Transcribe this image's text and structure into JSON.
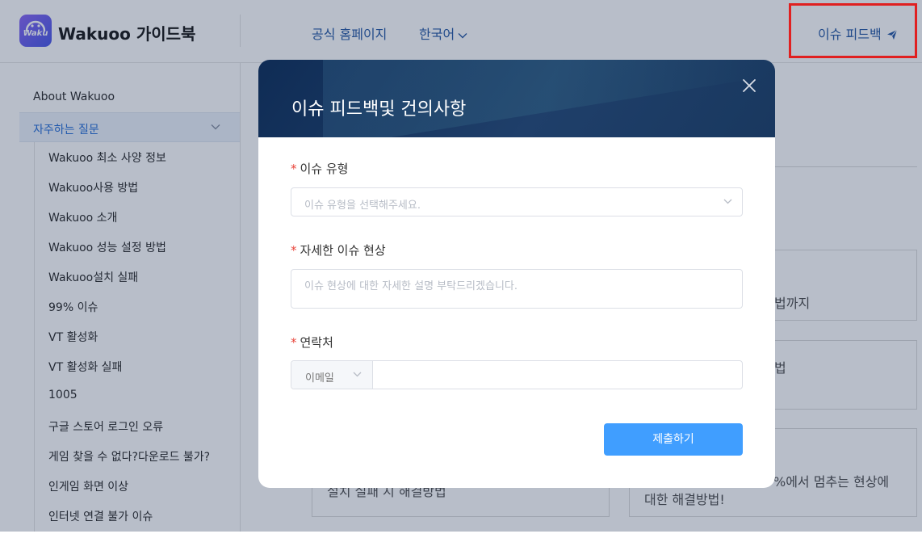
{
  "header": {
    "logo_text": "Waku",
    "brand_title": "Wakuoo 가이드북",
    "nav_home": "공식 홈페이지",
    "nav_lang": "한국어",
    "feedback_label": "이슈 피드백"
  },
  "sidebar": {
    "top_item": "About Wakuoo",
    "active_section": "자주하는 질문",
    "items": [
      "Wakuoo 최소 사양 정보",
      "Wakuoo사용 방법",
      "Wakuoo 소개",
      "Wakuoo 성능 설정 방법",
      "Wakuoo설치 실패",
      "99% 이슈",
      "VT 활성화",
      "VT 활성화 실패",
      "1005",
      "구글 스토어 로그인 오류",
      "게임 찾을 수 없다?다운로드 불가?",
      "인게임 화면 이상",
      "인터넷 연결 불가 이슈"
    ]
  },
  "main": {
    "card1_text": "법까지",
    "card2_text": "법",
    "card3_text": "설치 실패 시 해결방법",
    "card4_line1": "%에서 멈추는 현상에",
    "card4_line2": "대한 해결방법!"
  },
  "modal": {
    "title": "이슈 피드백및 건의사항",
    "required_mark": "*",
    "issue_type_label": "이슈 유형",
    "issue_type_placeholder": "이슈 유형을 선택해주세요.",
    "detail_label": "자세한 이슈 현상",
    "detail_placeholder": "이슈 현상에 대한 자세한 설명 부탁드리겠습니다.",
    "contact_label": "연락처",
    "contact_type": "이메일",
    "contact_value": "",
    "submit_label": "제출하기"
  },
  "colors": {
    "accent": "#409eff",
    "link": "#2e5fa8",
    "header_dark": "#0f2c55",
    "required": "#e8443a",
    "highlight": "#e02020"
  }
}
